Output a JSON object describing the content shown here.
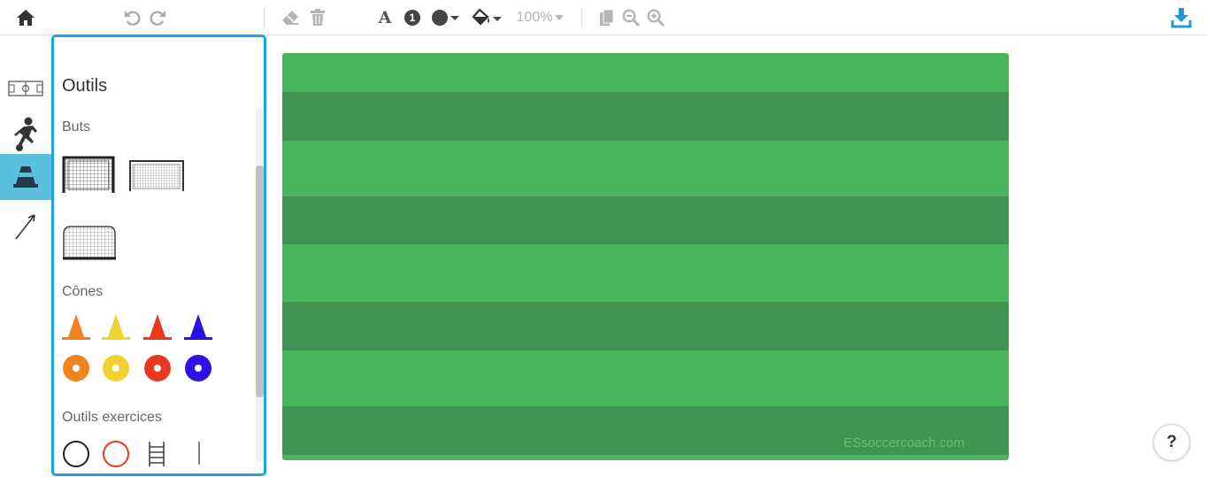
{
  "toolbar": {
    "icons": [
      "home-icon",
      "undo-icon",
      "redo-icon",
      "eraser-icon",
      "trash-icon",
      "text-icon",
      "number-icon",
      "shape-icon",
      "fill-icon",
      "copy-icon",
      "zoom-out-icon",
      "zoom-in-icon",
      "download-icon"
    ],
    "font_label": "A",
    "number_label": "1",
    "zoom_label": "100%",
    "accent": "#1a9cd8"
  },
  "rail": {
    "items": [
      "field-icon",
      "player-icon",
      "cone-icon",
      "arrow-icon"
    ],
    "active_index": 2,
    "active_color": "#5bc0de"
  },
  "panel": {
    "title": "Outils",
    "border_color": "#1ba4e6",
    "sections": {
      "goals": {
        "title": "Buts",
        "items": [
          "goal-large",
          "goal-medium",
          "goal-small"
        ]
      },
      "cones": {
        "title": "Cônes",
        "colors": [
          "#f0831e",
          "#eed330",
          "#e8391e",
          "#2b10e8"
        ]
      },
      "exercise_tools": {
        "title": "Outils exercices",
        "items": [
          "ring-black",
          "ring-red",
          "ladder",
          "pole"
        ]
      }
    }
  },
  "field": {
    "light_color": "#48b55c",
    "dark_color": "#3e9450",
    "watermark": "ESsoccercoach.com"
  },
  "help": {
    "label": "?"
  }
}
